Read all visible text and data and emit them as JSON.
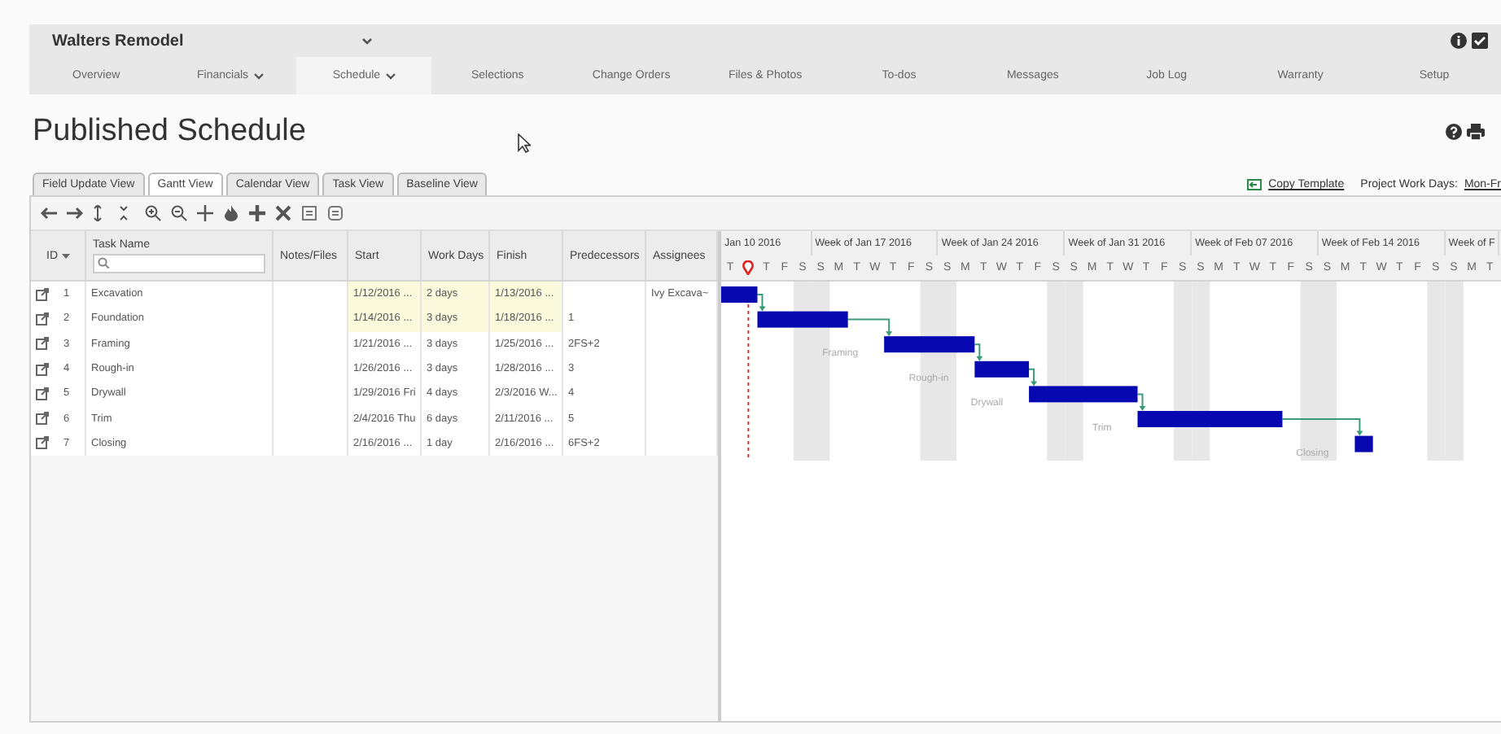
{
  "header": {
    "project": "Walters Remodel",
    "nav": [
      {
        "label": "Overview",
        "selected": false,
        "dropdown": false
      },
      {
        "label": "Financials",
        "selected": false,
        "dropdown": true
      },
      {
        "label": "Schedule",
        "selected": true,
        "dropdown": true
      },
      {
        "label": "Selections",
        "selected": false,
        "dropdown": false
      },
      {
        "label": "Change Orders",
        "selected": false,
        "dropdown": false
      },
      {
        "label": "Files & Photos",
        "selected": false,
        "dropdown": false
      },
      {
        "label": "To-dos",
        "selected": false,
        "dropdown": false
      },
      {
        "label": "Messages",
        "selected": false,
        "dropdown": false
      },
      {
        "label": "Job Log",
        "selected": false,
        "dropdown": false
      },
      {
        "label": "Warranty",
        "selected": false,
        "dropdown": false
      },
      {
        "label": "Setup",
        "selected": false,
        "dropdown": false
      }
    ]
  },
  "page": {
    "title": "Published Schedule"
  },
  "view_tabs": [
    {
      "label": "Field Update View",
      "selected": false
    },
    {
      "label": "Gantt View",
      "selected": true
    },
    {
      "label": "Calendar View",
      "selected": false
    },
    {
      "label": "Task View",
      "selected": false
    },
    {
      "label": "Baseline View",
      "selected": false
    }
  ],
  "links": {
    "copy_template": "Copy Template",
    "work_days_label": "Project Work Days:",
    "work_days_value": "Mon-Fr"
  },
  "grid": {
    "columns": [
      "ID",
      "Task Name",
      "Notes/Files",
      "Start",
      "Work Days",
      "Finish",
      "Predecessors",
      "Assignees"
    ],
    "rows": [
      {
        "id": "1",
        "name": "Excavation",
        "start": "1/12/2016 ...",
        "work_days": "2 days",
        "finish": "1/13/2016 ...",
        "assignees": "Ivy Excava~",
        "highlighted": true
      },
      {
        "id": "2",
        "name": "Foundation",
        "start": "1/14/2016 ...",
        "work_days": "3 days",
        "finish": "1/18/2016 ...",
        "predecessors": "1",
        "highlighted": true
      },
      {
        "id": "3",
        "name": "Framing",
        "start": "1/21/2016 ...",
        "work_days": "3 days",
        "finish": "1/25/2016 ...",
        "predecessors": "2FS+2",
        "highlighted": false,
        "bar_label": "Framing"
      },
      {
        "id": "4",
        "name": "Rough-in",
        "start": "1/26/2016 ...",
        "work_days": "3 days",
        "finish": "1/28/2016 ...",
        "predecessors": "3",
        "highlighted": false,
        "bar_label": "Rough-in"
      },
      {
        "id": "5",
        "name": "Drywall",
        "start": "1/29/2016 Fri",
        "work_days": "4 days",
        "finish": "2/3/2016 W...",
        "predecessors": "4",
        "highlighted": false,
        "bar_label": "Drywall"
      },
      {
        "id": "6",
        "name": "Trim",
        "start": "2/4/2016 Thu",
        "work_days": "6 days",
        "finish": "2/11/2016 ...",
        "predecessors": "5",
        "highlighted": false,
        "bar_label": "Trim"
      },
      {
        "id": "7",
        "name": "Closing",
        "start": "2/16/2016 ...",
        "work_days": "1 day",
        "finish": "2/16/2016 ...",
        "predecessors": "6FS+2",
        "highlighted": false,
        "bar_label": "Closing"
      }
    ]
  },
  "gantt": {
    "weeks": [
      {
        "label": "Jan 10 2016",
        "days": [
          {
            "kind": "day",
            "label": "T"
          },
          {
            "kind": "today"
          },
          {
            "kind": "day",
            "label": "T"
          },
          {
            "kind": "day",
            "label": "F"
          },
          {
            "kind": "day",
            "label": "S"
          }
        ]
      },
      {
        "label": "Week of Jan 17 2016",
        "days": [
          {
            "kind": "day",
            "label": "S"
          },
          {
            "kind": "day",
            "label": "M"
          },
          {
            "kind": "day",
            "label": "T"
          },
          {
            "kind": "day",
            "label": "W"
          },
          {
            "kind": "day",
            "label": "T"
          },
          {
            "kind": "day",
            "label": "F"
          },
          {
            "kind": "day",
            "label": "S"
          }
        ]
      },
      {
        "label": "Week of Jan 24 2016",
        "days": [
          {
            "kind": "day",
            "label": "S"
          },
          {
            "kind": "day",
            "label": "M"
          },
          {
            "kind": "day",
            "label": "T"
          },
          {
            "kind": "day",
            "label": "W"
          },
          {
            "kind": "day",
            "label": "T"
          },
          {
            "kind": "day",
            "label": "F"
          },
          {
            "kind": "day",
            "label": "S"
          }
        ]
      },
      {
        "label": "Week of Jan 31 2016",
        "days": [
          {
            "kind": "day",
            "label": "S"
          },
          {
            "kind": "day",
            "label": "M"
          },
          {
            "kind": "day",
            "label": "T"
          },
          {
            "kind": "day",
            "label": "W"
          },
          {
            "kind": "day",
            "label": "T"
          },
          {
            "kind": "day",
            "label": "F"
          },
          {
            "kind": "day",
            "label": "S"
          }
        ]
      },
      {
        "label": "Week of Feb 07 2016",
        "days": [
          {
            "kind": "day",
            "label": "S"
          },
          {
            "kind": "day",
            "label": "M"
          },
          {
            "kind": "day",
            "label": "T"
          },
          {
            "kind": "day",
            "label": "W"
          },
          {
            "kind": "day",
            "label": "T"
          },
          {
            "kind": "day",
            "label": "F"
          },
          {
            "kind": "day",
            "label": "S"
          }
        ]
      },
      {
        "label": "Week of Feb 14 2016",
        "days": [
          {
            "kind": "day",
            "label": "S"
          },
          {
            "kind": "day",
            "label": "M"
          },
          {
            "kind": "day",
            "label": "T"
          },
          {
            "kind": "day",
            "label": "W"
          },
          {
            "kind": "day",
            "label": "T"
          },
          {
            "kind": "day",
            "label": "F"
          },
          {
            "kind": "day",
            "label": "S"
          }
        ]
      },
      {
        "label": "Week of F",
        "days": [
          {
            "kind": "day",
            "label": "S"
          },
          {
            "kind": "day",
            "label": "M"
          },
          {
            "kind": "day",
            "label": "T"
          }
        ]
      }
    ]
  }
}
